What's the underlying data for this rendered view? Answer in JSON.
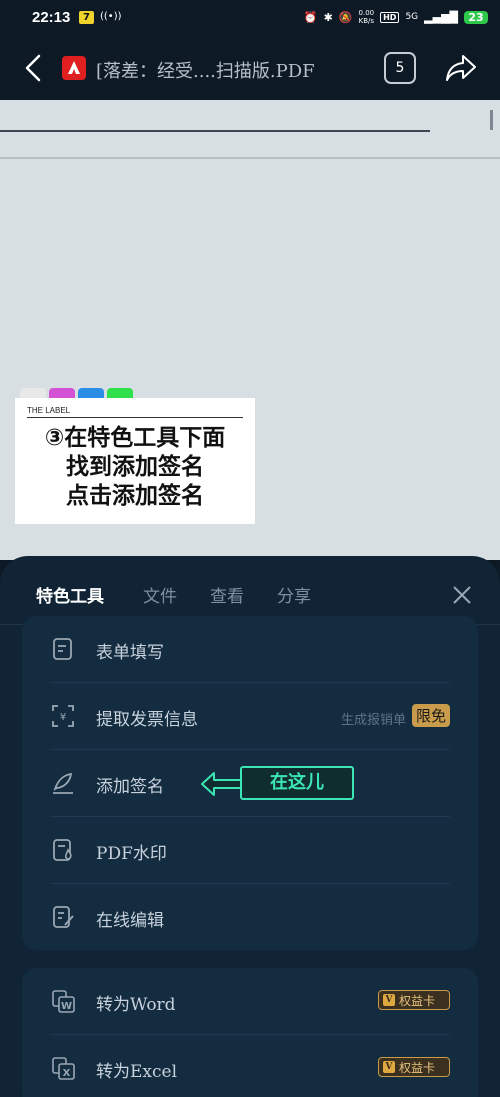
{
  "status_bar": {
    "time": "22:13",
    "app_badge": "7",
    "net_speed_top": "0.00",
    "net_speed_bottom": "KB/s",
    "hd": "HD",
    "signal": "5G",
    "battery": "23"
  },
  "top_bar": {
    "title": "[落差：经受....扫描版.PDF",
    "page_count": "5"
  },
  "document": {
    "label_card": {
      "tab_colors": [
        "#e8e8e8",
        "#d451d6",
        "#2a8de6",
        "#2ee04a"
      ],
      "header": "THE LABEL",
      "text": "③在特色工具下面\n找到添加签名\n点击添加签名"
    }
  },
  "sheet": {
    "tabs": [
      {
        "label": "特色工具",
        "active": true
      },
      {
        "label": "文件",
        "active": false
      },
      {
        "label": "查看",
        "active": false
      },
      {
        "label": "分享",
        "active": false
      }
    ],
    "group1": [
      {
        "icon": "form-icon",
        "label": "表单填写"
      },
      {
        "icon": "invoice-scan-icon",
        "label": "提取发票信息",
        "hint": "生成报销单",
        "badge": "限免"
      },
      {
        "icon": "signature-pen-icon",
        "label": "添加签名"
      },
      {
        "icon": "watermark-icon",
        "label": "PDF水印"
      },
      {
        "icon": "edit-document-icon",
        "label": "在线编辑"
      }
    ],
    "group2": [
      {
        "icon": "convert-word-icon",
        "label": "转为Word",
        "badge": "权益卡"
      },
      {
        "icon": "convert-excel-icon",
        "label": "转为Excel",
        "badge": "权益卡"
      }
    ],
    "annotation": {
      "text": "在这儿",
      "color": "#3be6b4"
    }
  }
}
